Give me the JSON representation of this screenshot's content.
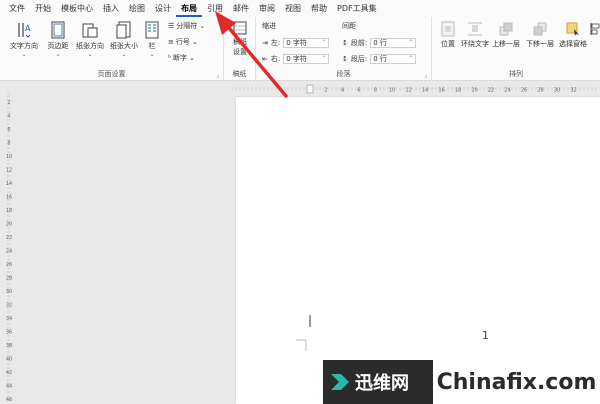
{
  "menu": {
    "items": [
      "文件",
      "开始",
      "模板中心",
      "插入",
      "绘图",
      "设计",
      "布局",
      "引用",
      "邮件",
      "审阅",
      "视图",
      "帮助",
      "PDF工具集"
    ],
    "active_index": 6
  },
  "ribbon": {
    "page_setup": {
      "label": "页面设置",
      "text_direction": "文字方向",
      "margins": "页边距",
      "orientation": "纸张方向",
      "size": "纸张大小",
      "columns": "栏",
      "breaks": "分隔符",
      "line_numbers": "行号",
      "hyphenation": "断字"
    },
    "draft_paper": {
      "label": "稿纸",
      "button_line1": "稿纸",
      "button_line2": "设置"
    },
    "paragraph": {
      "label": "段落",
      "indent_title": "缩进",
      "spacing_title": "间距",
      "left_label": "左:",
      "left_value": "0 字符",
      "right_label": "右:",
      "right_value": "0 字符",
      "before_label": "段前:",
      "before_value": "0 行",
      "after_label": "段后:",
      "after_value": "0 行"
    },
    "arrange": {
      "label": "排列",
      "position": "位置",
      "wrap_text": "环绕文字",
      "bring_forward": "上移一层",
      "send_backward": "下移一层",
      "selection_pane": "选择窗格"
    }
  },
  "ruler": {
    "h_numbers": [
      "2",
      "4",
      "6",
      "8",
      "10",
      "12",
      "14",
      "16",
      "18",
      "20",
      "22",
      "24",
      "26",
      "28",
      "30",
      "32"
    ],
    "v_numbers": [
      "2",
      "4",
      "6",
      "8",
      "10",
      "12",
      "14",
      "16",
      "18",
      "20",
      "22",
      "24",
      "26",
      "28",
      "30",
      "32",
      "34",
      "36",
      "38",
      "40",
      "42",
      "44",
      "46"
    ]
  },
  "document": {
    "page_number": "1"
  },
  "watermark": {
    "cn_text": "迅维网",
    "en_text": "Chinafix.com"
  },
  "colors": {
    "arrow": "#e02a2a",
    "watermark_bg": "#2b2b2b",
    "logo": "#2bb8a4",
    "active_tab": "#1d5fbf"
  }
}
